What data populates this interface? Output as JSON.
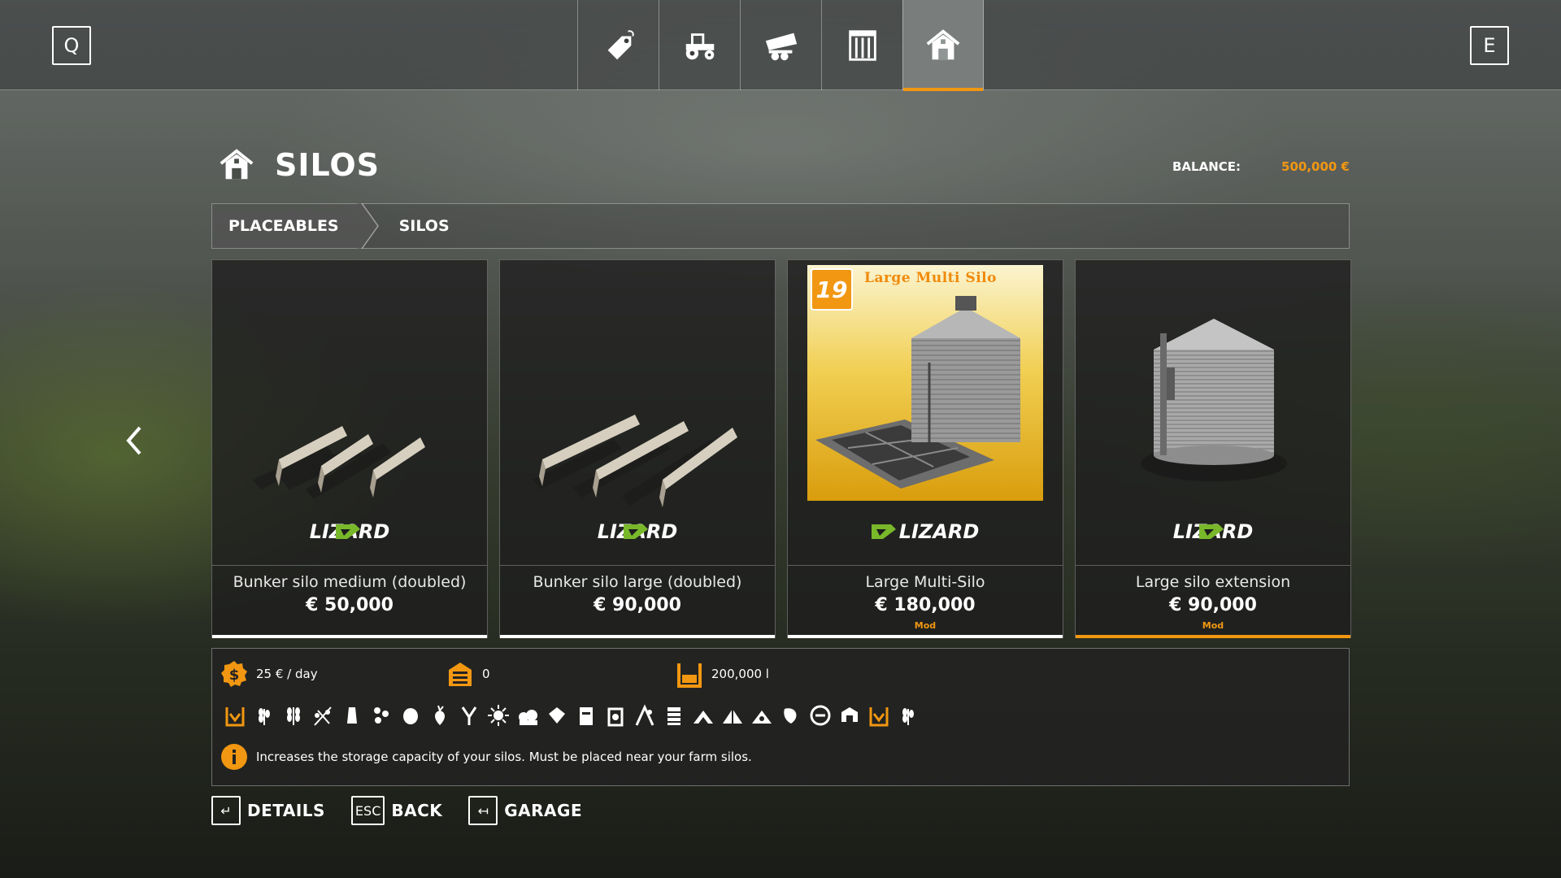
{
  "topbar": {
    "left_key": "Q",
    "right_key": "E",
    "tabs": [
      {
        "icon": "price-tag-icon",
        "active": false
      },
      {
        "icon": "tractor-icon",
        "active": false
      },
      {
        "icon": "trailer-icon",
        "active": false
      },
      {
        "icon": "pallet-icon",
        "active": false
      },
      {
        "icon": "barn-icon",
        "active": true
      }
    ]
  },
  "header": {
    "icon": "barn-icon",
    "title": "SILOS",
    "balance_label": "BALANCE:",
    "balance_value": "500,000 €"
  },
  "breadcrumb": [
    "PLACEABLES",
    "SILOS"
  ],
  "cards": [
    {
      "name": "Bunker silo medium (doubled)",
      "price": "€ 50,000",
      "brand": "LIZARD",
      "mod": "",
      "selected": false,
      "image": "bunker-walls"
    },
    {
      "name": "Bunker silo large (doubled)",
      "price": "€ 90,000",
      "brand": "LIZARD",
      "mod": "",
      "selected": false,
      "image": "bunker-walls"
    },
    {
      "name": "Large Multi-Silo",
      "price": "€ 180,000",
      "brand": "LIZARD",
      "mod": "Mod",
      "selected": false,
      "image": "multi-silo-poster",
      "image_text": "Large Multi Silo",
      "image_badge": "19"
    },
    {
      "name": "Large silo extension",
      "price": "€ 90,000",
      "brand": "LIZARD",
      "mod": "Mod",
      "selected": true,
      "image": "round-silo"
    }
  ],
  "info": {
    "upkeep": "25 € / day",
    "income": "0",
    "capacity": "200,000 l",
    "description": "Increases the storage capacity of your silos. Must be placed near your farm silos.",
    "filltype_icons": [
      "silo-icon",
      "wheat-icon",
      "barley-icon",
      "oat-icon",
      "canola-icon",
      "sorghum-icon",
      "potato-icon",
      "sugarbeet-icon",
      "soybean-icon",
      "sunflower-icon",
      "cotton-icon",
      "chaff-icon",
      "grass-icon",
      "seeds-icon",
      "fertilizer-icon",
      "straw-icon",
      "corn-icon",
      "wood-chips-icon",
      "silage-icon",
      "hay-icon",
      "forage-icon",
      "manure-icon",
      "bale-icon",
      "greenhouse-icon"
    ]
  },
  "footer": [
    {
      "key": "↵",
      "label": "DETAILS"
    },
    {
      "key": "ESC",
      "label": "BACK"
    },
    {
      "key": "↤",
      "label": "GARAGE"
    }
  ],
  "colors": {
    "accent": "#f29711",
    "panel": "#232323"
  }
}
